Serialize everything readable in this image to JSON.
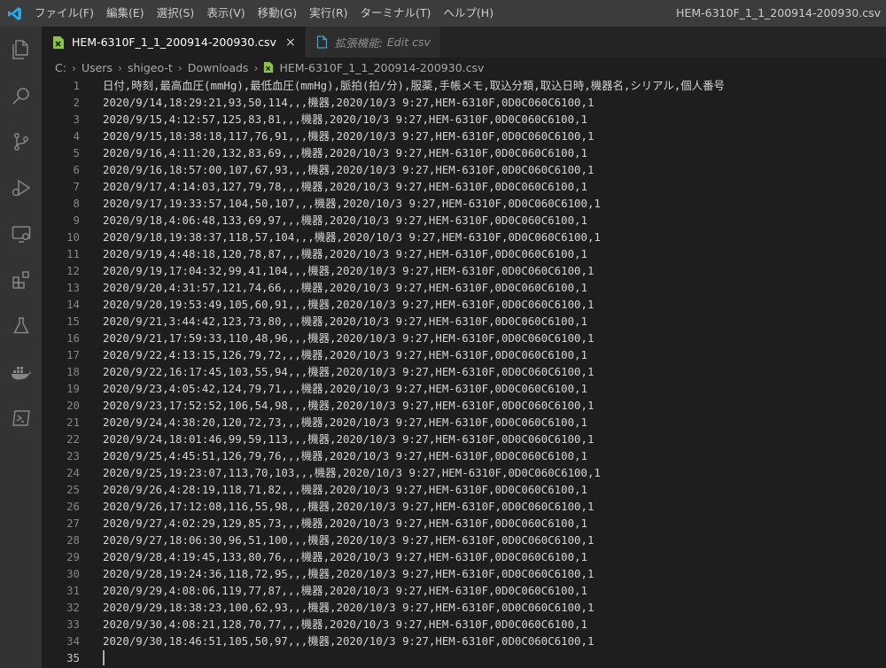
{
  "titlebar": {
    "menu": [
      "ファイル(F)",
      "編集(E)",
      "選択(S)",
      "表示(V)",
      "移動(G)",
      "実行(R)",
      "ターミナル(T)",
      "ヘルプ(H)"
    ],
    "window_title": "HEM-6310F_1_1_200914-200930.csv"
  },
  "activity_bar": {
    "icons": [
      "files-icon",
      "search-icon",
      "source-control-icon",
      "run-debug-icon",
      "remote-explorer-icon",
      "extensions-icon",
      "testing-icon",
      "docker-icon",
      "terminal-icon"
    ]
  },
  "tabs": [
    {
      "label": "HEM-6310F_1_1_200914-200930.csv",
      "active": true,
      "close": "×"
    },
    {
      "label": "拡張機能:",
      "preview_label": "Edit csv",
      "active": false
    }
  ],
  "breadcrumb": [
    "C:",
    "Users",
    "shigeo-t",
    "Downloads",
    "HEM-6310F_1_1_200914-200930.csv"
  ],
  "editor": {
    "lines": [
      "日付,時刻,最高血圧(mmHg),最低血圧(mmHg),脈拍(拍/分),服薬,手帳メモ,取込分類,取込日時,機器名,シリアル,個人番号",
      "2020/9/14,18:29:21,93,50,114,,,機器,2020/10/3 9:27,HEM-6310F,0D0C060C6100,1",
      "2020/9/15,4:12:57,125,83,81,,,機器,2020/10/3 9:27,HEM-6310F,0D0C060C6100,1",
      "2020/9/15,18:38:18,117,76,91,,,機器,2020/10/3 9:27,HEM-6310F,0D0C060C6100,1",
      "2020/9/16,4:11:20,132,83,69,,,機器,2020/10/3 9:27,HEM-6310F,0D0C060C6100,1",
      "2020/9/16,18:57:00,107,67,93,,,機器,2020/10/3 9:27,HEM-6310F,0D0C060C6100,1",
      "2020/9/17,4:14:03,127,79,78,,,機器,2020/10/3 9:27,HEM-6310F,0D0C060C6100,1",
      "2020/9/17,19:33:57,104,50,107,,,機器,2020/10/3 9:27,HEM-6310F,0D0C060C6100,1",
      "2020/9/18,4:06:48,133,69,97,,,機器,2020/10/3 9:27,HEM-6310F,0D0C060C6100,1",
      "2020/9/18,19:38:37,118,57,104,,,機器,2020/10/3 9:27,HEM-6310F,0D0C060C6100,1",
      "2020/9/19,4:48:18,120,78,87,,,機器,2020/10/3 9:27,HEM-6310F,0D0C060C6100,1",
      "2020/9/19,17:04:32,99,41,104,,,機器,2020/10/3 9:27,HEM-6310F,0D0C060C6100,1",
      "2020/9/20,4:31:57,121,74,66,,,機器,2020/10/3 9:27,HEM-6310F,0D0C060C6100,1",
      "2020/9/20,19:53:49,105,60,91,,,機器,2020/10/3 9:27,HEM-6310F,0D0C060C6100,1",
      "2020/9/21,3:44:42,123,73,80,,,機器,2020/10/3 9:27,HEM-6310F,0D0C060C6100,1",
      "2020/9/21,17:59:33,110,48,96,,,機器,2020/10/3 9:27,HEM-6310F,0D0C060C6100,1",
      "2020/9/22,4:13:15,126,79,72,,,機器,2020/10/3 9:27,HEM-6310F,0D0C060C6100,1",
      "2020/9/22,16:17:45,103,55,94,,,機器,2020/10/3 9:27,HEM-6310F,0D0C060C6100,1",
      "2020/9/23,4:05:42,124,79,71,,,機器,2020/10/3 9:27,HEM-6310F,0D0C060C6100,1",
      "2020/9/23,17:52:52,106,54,98,,,機器,2020/10/3 9:27,HEM-6310F,0D0C060C6100,1",
      "2020/9/24,4:38:20,120,72,73,,,機器,2020/10/3 9:27,HEM-6310F,0D0C060C6100,1",
      "2020/9/24,18:01:46,99,59,113,,,機器,2020/10/3 9:27,HEM-6310F,0D0C060C6100,1",
      "2020/9/25,4:45:51,126,79,76,,,機器,2020/10/3 9:27,HEM-6310F,0D0C060C6100,1",
      "2020/9/25,19:23:07,113,70,103,,,機器,2020/10/3 9:27,HEM-6310F,0D0C060C6100,1",
      "2020/9/26,4:28:19,118,71,82,,,機器,2020/10/3 9:27,HEM-6310F,0D0C060C6100,1",
      "2020/9/26,17:12:08,116,55,98,,,機器,2020/10/3 9:27,HEM-6310F,0D0C060C6100,1",
      "2020/9/27,4:02:29,129,85,73,,,機器,2020/10/3 9:27,HEM-6310F,0D0C060C6100,1",
      "2020/9/27,18:06:30,96,51,100,,,機器,2020/10/3 9:27,HEM-6310F,0D0C060C6100,1",
      "2020/9/28,4:19:45,133,80,76,,,機器,2020/10/3 9:27,HEM-6310F,0D0C060C6100,1",
      "2020/9/28,19:24:36,118,72,95,,,機器,2020/10/3 9:27,HEM-6310F,0D0C060C6100,1",
      "2020/9/29,4:08:06,119,77,87,,,機器,2020/10/3 9:27,HEM-6310F,0D0C060C6100,1",
      "2020/9/29,18:38:23,100,62,93,,,機器,2020/10/3 9:27,HEM-6310F,0D0C060C6100,1",
      "2020/9/30,4:08:21,128,70,77,,,機器,2020/10/3 9:27,HEM-6310F,0D0C060C6100,1",
      "2020/9/30,18:46:51,105,50,97,,,機器,2020/10/3 9:27,HEM-6310F,0D0C060C6100,1",
      ""
    ]
  },
  "colors": {
    "title_bar": "#3c3c3c",
    "activity_bar": "#333333",
    "editor_bg": "#1e1e1e",
    "vscode_logo": "#23a9f2",
    "csv_icon": "#8dc149",
    "preview_icon": "#519aba"
  }
}
